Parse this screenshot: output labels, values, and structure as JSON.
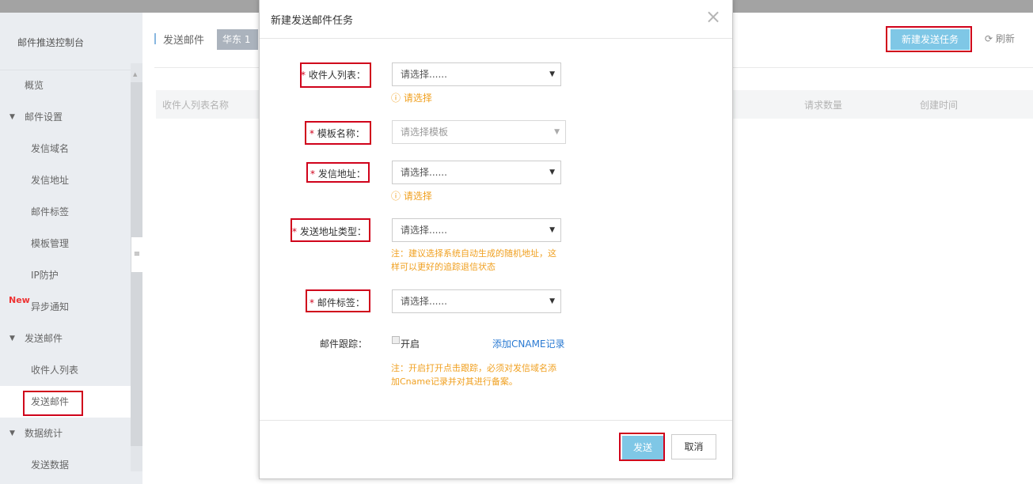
{
  "sidebar": {
    "title": "邮件推送控制台",
    "items": [
      {
        "label": "概览"
      },
      {
        "label": "邮件设置"
      },
      {
        "label": "发信域名"
      },
      {
        "label": "发信地址"
      },
      {
        "label": "邮件标签"
      },
      {
        "label": "模板管理"
      },
      {
        "label": "IP防护"
      },
      {
        "label": "异步通知",
        "badge": "New"
      },
      {
        "label": "发送邮件"
      },
      {
        "label": "收件人列表"
      },
      {
        "label": "发送邮件"
      },
      {
        "label": "数据统计"
      },
      {
        "label": "发送数据"
      }
    ]
  },
  "main": {
    "title": "发送邮件",
    "region": "华东 1",
    "new_task_label": "新建发送任务",
    "refresh_label": "刷新",
    "columns": [
      "收件人列表名称",
      "请求数量",
      "创建时间"
    ]
  },
  "modal": {
    "title": "新建发送邮件任务",
    "close_icon": "×",
    "fields": {
      "recipient_list": {
        "label": "收件人列表：",
        "value": "请选择......",
        "warning": "请选择"
      },
      "template": {
        "label": "模板名称：",
        "placeholder": "请选择模板"
      },
      "sender_address": {
        "label": "发信地址：",
        "value": "请选择......",
        "warning": "请选择"
      },
      "address_type": {
        "label": "发送地址类型：",
        "value": "请选择......",
        "note": "注：建议选择系统自动生成的随机地址，这样可以更好的追踪退信状态"
      },
      "mail_tag": {
        "label": "邮件标签：",
        "value": "请选择......"
      },
      "tracking": {
        "label": "邮件跟踪：",
        "checkbox_label": "开启",
        "link": "添加CNAME记录",
        "note": "注：开启打开点击跟踪，必须对发信域名添加Cname记录并对其进行备案。"
      }
    },
    "send_label": "发送",
    "cancel_label": "取消"
  },
  "colors": {
    "accent_button": "#7fc7e6",
    "highlight": "#d0021b",
    "warning": "#f0a020",
    "link": "#2a7ad2"
  },
  "icons": {
    "warning": "⓵"
  }
}
